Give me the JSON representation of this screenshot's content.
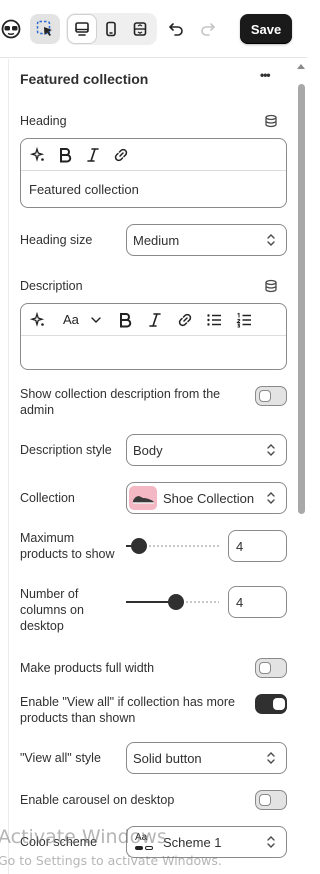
{
  "toolbar": {
    "save_label": "Save",
    "icons": [
      "app-logo-icon",
      "inspector-cursor-icon",
      "desktop-view-icon",
      "mobile-view-icon",
      "fullscreen-view-icon",
      "undo-icon",
      "redo-icon"
    ]
  },
  "section": {
    "title": "Featured collection",
    "more_label": "•••"
  },
  "heading": {
    "label": "Heading",
    "value": "Featured collection"
  },
  "heading_size": {
    "label": "Heading size",
    "value": "Medium"
  },
  "description": {
    "label": "Description",
    "value": "",
    "font_menu_label": "Aa"
  },
  "show_desc": {
    "label": "Show collection description from the admin",
    "enabled": false
  },
  "description_style": {
    "label": "Description style",
    "value": "Body"
  },
  "collection": {
    "label": "Collection",
    "value": "Shoe Collection"
  },
  "max_products": {
    "label": "Maximum products to show",
    "value": "4",
    "fraction": 0.06
  },
  "columns_desktop": {
    "label": "Number of columns on desktop",
    "value": "4",
    "fraction": 0.55
  },
  "full_width": {
    "label": "Make products full width",
    "enabled": false
  },
  "view_all": {
    "label": "Enable \"View all\" if collection has more products than shown",
    "enabled": true
  },
  "view_all_style": {
    "label": "\"View all\" style",
    "value": "Solid button"
  },
  "carousel": {
    "label": "Enable carousel on desktop",
    "enabled": false
  },
  "color_scheme": {
    "label": "Color scheme",
    "value": "Scheme 1",
    "swatch_label": "Aa"
  },
  "watermark": {
    "line1": "Activate Windows",
    "line2": "Go to Settings to activate Windows."
  },
  "colors": {
    "accent_dark": "#303030",
    "save_bg": "#1a1a1a",
    "collection_thumb_bg": "#f4b8c4"
  }
}
